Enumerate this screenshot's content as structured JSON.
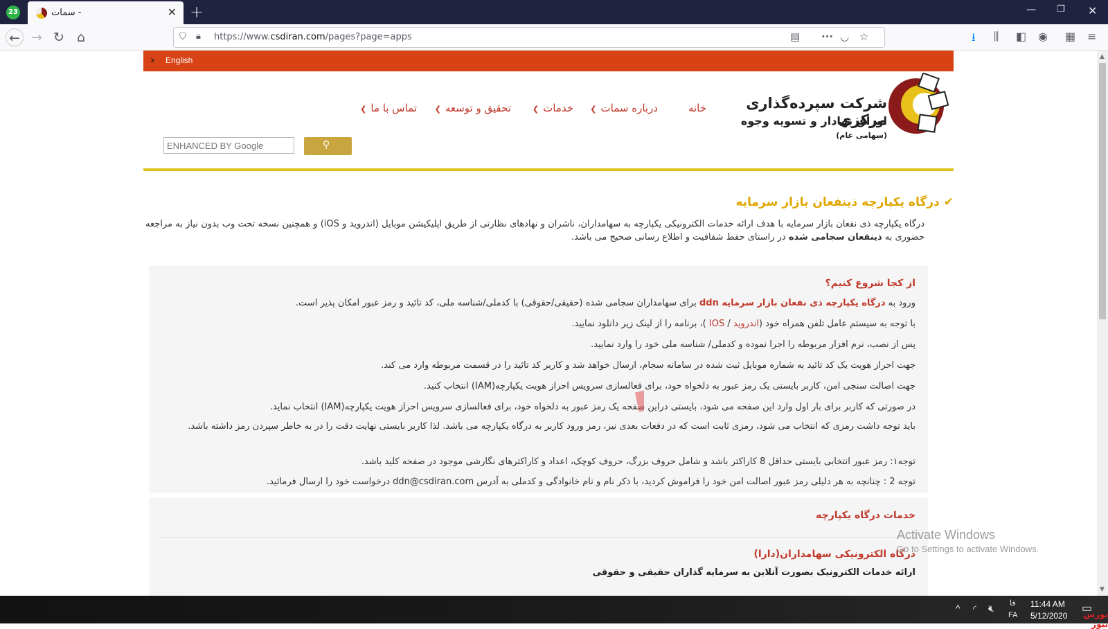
{
  "browser": {
    "app_badge": "23",
    "tab_title": "سمات -",
    "url_prefix": "https://www.",
    "url_host": "csdiran.com",
    "url_path": "/pages?page=apps"
  },
  "site": {
    "language_link": "English",
    "logo_line1": "شرکت سپرده‌گذاری مرکزی",
    "logo_line2": "اوراق بهادار و تسویه وجوه",
    "logo_line2_suffix": "(سهامی عام)",
    "menu": [
      {
        "label": "خانه"
      },
      {
        "label": "درباره سمات"
      },
      {
        "label": "خدمات"
      },
      {
        "label": "تحقیق و توسعه"
      },
      {
        "label": "تماس با ما"
      }
    ],
    "search_placeholder": "ENHANCED BY Google"
  },
  "content": {
    "section_title": "درگاه یکپارچه ذینفعان بازار سرمایه",
    "intro_a": "درگاه یکپارچه ذی نفعان بازار سرمایه با هدف ارائه خدمات الکترونیکی یکپارچه به سهامداران، ناشران و نهادهای نظارتی از طریق اپلیکیشن موبایل (اندروید و iOS) و همچنین نسخه تحت وب بدون نیاز به مراجعه حضوری به ",
    "intro_bold": "ذینفعان سجامی شده",
    "intro_b": " در راستای حفظ شفافیت و اطلاع رسانی صحیح می باشد.",
    "start_heading": "از کجا شروع کنیم؟",
    "line1_a": "ورود به ",
    "line1_link": "درگاه یکپارچه ذی نفعان بازار سرمایه ddn",
    "line1_b": " برای سهامداران سجامی شده (حقیقی/حقوقی) با کدملی/شناسه ملی، کد تائید و رمز عبور امکان پذیر است.",
    "line2_a": "با توجه به سیستم عامل تلفن همراه خود (",
    "line2_android": "اندروید",
    "line2_sep": " / ",
    "line2_ios": "IOS",
    "line2_b": " )، برنامه را از لینک زیر دانلود نمایید.",
    "line3": "پس از نصب، نرم افزار مربوطه را اجرا نموده و کدملی/ شناسه ملی خود را وارد نمایید.",
    "line4": "جهت احراز هویت یک کد تائید به شماره موبایل ثبت شده در سامانه سجام، ارسال خواهد شد و کاربر کد تائید را در قسمت مربوطه وارد می کند.",
    "line5": "جهت اصالت سنجی امن، کاربر بایستی یک رمز عبور به دلخواه خود، برای فعالسازی سرویس احراز هویت یکپارچه(IAM) انتخاب کنید.",
    "line6": "در صورتی که کاربر برای بار اول وارد این صفحه می شود، بایستی دراین صفحه یک رمز عبور به دلخواه خود، برای فعالسازی سرویس احراز هویت یکپارچه(IAM) انتخاب نماید.",
    "line7": "باید توجه داشت رمزی که انتخاب می شود، رمزی ثابت است که در دفعات بعدی نیز، رمز ورود کاربر به درگاه یکپارچه می باشد. لذا کاربر بایستی نهایت دقت را در به خاطر سپردن رمز داشته باشد.",
    "line8": "توجه۱: رمز عبور انتخابی بایستی حداقل 8 کاراکتر باشد و شامل حروف بزرگ، حروف کوچک، اعداد و کاراکترهای نگارشی موجود در صفحه کلید باشد.",
    "line9_a": "توجه 2 : چنانچه به هر دلیلی رمز عبور اصالت امن خود را فراموش کردید، با ذکر نام و نام خانوادگی و کدملی به آدرس ",
    "line9_email": "ddn@csdiran.com",
    "line9_b": " درخواست خود را ارسال فرمائید.",
    "services_heading": "خدمات درگاه یکپارچه",
    "dara_heading": "درگاه الکترونیکی سهامداران(دارا)",
    "dara_desc": "ارائه خدمات الکترونیک بصورت آنلاین به سرمایه گذاران حقیقی و حقوقی"
  },
  "overlay": {
    "activate_title": "Activate Windows",
    "activate_sub": "Go to Settings to activate Windows.",
    "watermark_text": "بورس نیوز"
  },
  "taskbar": {
    "lang_top": "فا",
    "lang_bottom": "FA",
    "time": "11:44 AM",
    "date": "5/12/2020",
    "brand": "بورس نیوز"
  }
}
